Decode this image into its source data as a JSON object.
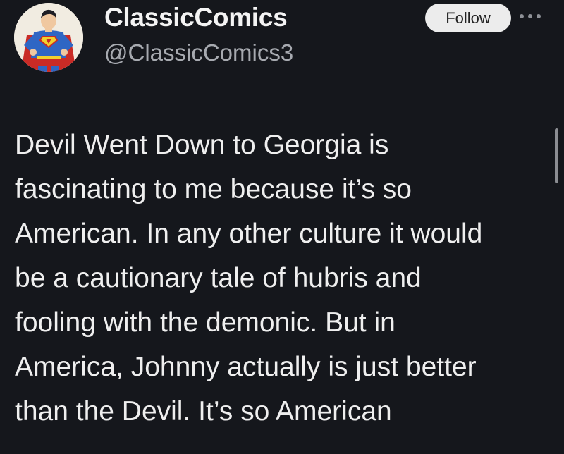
{
  "author": {
    "display_name": "ClassicComics",
    "handle": "@ClassicComics3",
    "avatar_icon": "superman-avatar-icon"
  },
  "actions": {
    "follow_label": "Follow",
    "more_icon": "more-options-icon"
  },
  "post": {
    "lines": [
      "Devil Went Down to Georgia is",
      "fascinating to me because it’s so",
      "American. In any other culture it would",
      "be a cautionary tale of hubris and",
      "fooling with the demonic. But in",
      "America, Johnny actually is just better",
      "than the Devil. It’s so American"
    ]
  },
  "colors": {
    "background": "#15171c",
    "text": "#efefef",
    "handle": "#a7aab0",
    "follow_button": "#ececec"
  }
}
